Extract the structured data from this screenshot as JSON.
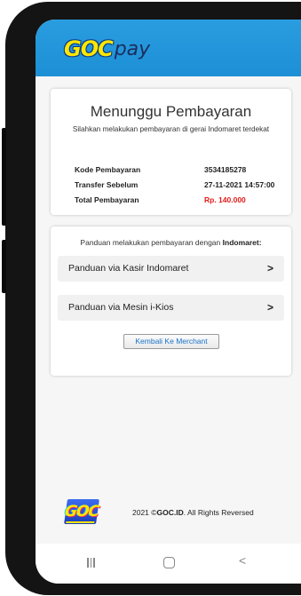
{
  "brand": {
    "logo_text": "GOC",
    "pay_text": "pay"
  },
  "payment": {
    "title": "Menunggu Pembayaran",
    "subtitle": "Silahkan melakukan pembayaran di gerai Indomaret terdekat",
    "rows": [
      {
        "label": "Kode Pembayaran",
        "value": "3534185278"
      },
      {
        "label": "Transfer Sebelum",
        "value": "27-11-2021 14:57:00"
      },
      {
        "label": "Total Pembayaran",
        "value": "Rp. 140.000"
      }
    ],
    "total_color": "#e21b1b"
  },
  "guide": {
    "intro": "Panduan melakukan pembayaran dengan",
    "intro_bold": "Indomaret:",
    "items": [
      {
        "label": "Panduan via Kasir Indomaret",
        "icon": "chevron-right-icon"
      },
      {
        "label": "Panduan via Mesin i-Kios",
        "icon": "chevron-right-icon"
      }
    ],
    "back_button": "Kembali Ke Merchant"
  },
  "footer": {
    "logo_text": "GOC",
    "copyright_prefix": "2021 ©",
    "copyright_brand": "GOC.ID",
    "copyright_suffix": ". All Rights Reversed"
  },
  "colors": {
    "topbar": "#1d8fd6",
    "logo_yellow": "#ffe600",
    "link_blue": "#1a73c9"
  }
}
